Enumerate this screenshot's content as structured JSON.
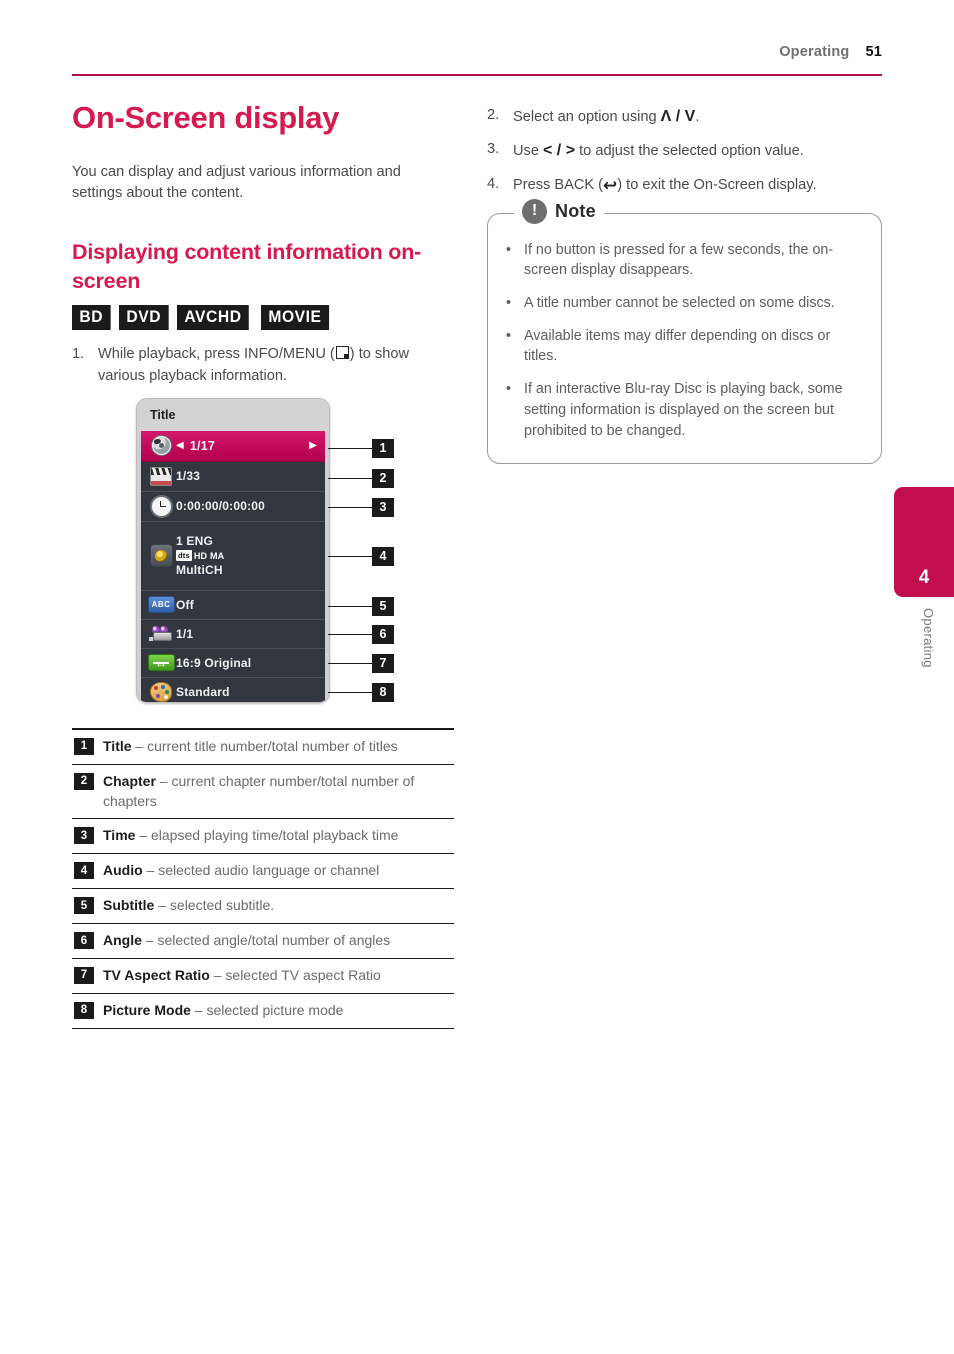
{
  "header": {
    "section": "Operating",
    "page_number": "51"
  },
  "left": {
    "title": "On-Screen display",
    "intro": "You can display and adjust various information and settings about the content.",
    "subheading": "Displaying content information on-screen",
    "badges": [
      "BD",
      "DVD",
      "AVCHD",
      "MOVIE"
    ],
    "step1": {
      "number": "1.",
      "text_before": "While playback, press INFO/MENU (",
      "text_after": ") to show various playback information."
    }
  },
  "right": {
    "step2": {
      "number": "2.",
      "text_before": "Select an option using ",
      "keys": "Λ / V",
      "text_after": "."
    },
    "step3": {
      "number": "3.",
      "text_before": "Use ",
      "keys": "< / >",
      "text_after": " to adjust the selected option value."
    },
    "step4": {
      "number": "4.",
      "text_before": "Press BACK (",
      "icon": "↩",
      "text_after": ") to exit the On-Screen display."
    },
    "note": {
      "label": "Note",
      "badge": "!",
      "items": [
        "If no button is pressed for a few seconds, the on-screen display disappears.",
        "A title number cannot be selected on some discs.",
        "Available items may differ depending on discs or titles.",
        " If an interactive Blu-ray Disc is playing back, some setting information is displayed on the screen but prohibited to be changed."
      ]
    }
  },
  "osd": {
    "title": "Title",
    "arrow_left": "◀",
    "arrow_right": "▶",
    "rows": [
      {
        "callout": "1",
        "icon": "disc-icon",
        "value": "1/17",
        "selected": true
      },
      {
        "callout": "2",
        "icon": "clapperboard-icon",
        "value": "1/33",
        "selected": false
      },
      {
        "callout": "3",
        "icon": "clock-icon",
        "value": "0:00:00/0:00:00",
        "selected": false
      },
      {
        "callout": "4",
        "icon": "audio-speaker-icon",
        "value": "1 ENG",
        "value2": "dts",
        "value2b": "HD MA",
        "value3": "MultiCH",
        "selected": false
      },
      {
        "callout": "5",
        "icon": "abc-subtitle-icon",
        "value": "Off",
        "selected": false
      },
      {
        "callout": "6",
        "icon": "camera-angle-icon",
        "value": "1/1",
        "selected": false
      },
      {
        "callout": "7",
        "icon": "aspect-ratio-icon",
        "value": "16:9 Original",
        "selected": false
      },
      {
        "callout": "8",
        "icon": "palette-icon",
        "value": "Standard",
        "selected": false
      }
    ]
  },
  "definitions": [
    {
      "num": "1",
      "term": "Title",
      "desc": " – current title number/total number of titles"
    },
    {
      "num": "2",
      "term": "Chapter",
      "desc": " – current chapter number/total number of chapters"
    },
    {
      "num": "3",
      "term": "Time",
      "desc": " – elapsed playing time/total playback time"
    },
    {
      "num": "4",
      "term": "Audio",
      "desc": " – selected audio language or channel"
    },
    {
      "num": "5",
      "term": "Subtitle",
      "desc": " – selected subtitle."
    },
    {
      "num": "6",
      "term": "Angle",
      "desc": " – selected angle/total number of angles"
    },
    {
      "num": "7",
      "term": "TV Aspect Ratio",
      "desc": " – selected TV aspect Ratio"
    },
    {
      "num": "8",
      "term": "Picture Mode",
      "desc": " – selected picture mode"
    }
  ],
  "side_tab": {
    "chapter": "4",
    "label": "Operating"
  },
  "colors": {
    "accent": "#d6194e",
    "tab": "#c20e4d",
    "rule": "#b3124a",
    "osd_selected": "#c2135c",
    "osd_bg": "#32373f"
  }
}
